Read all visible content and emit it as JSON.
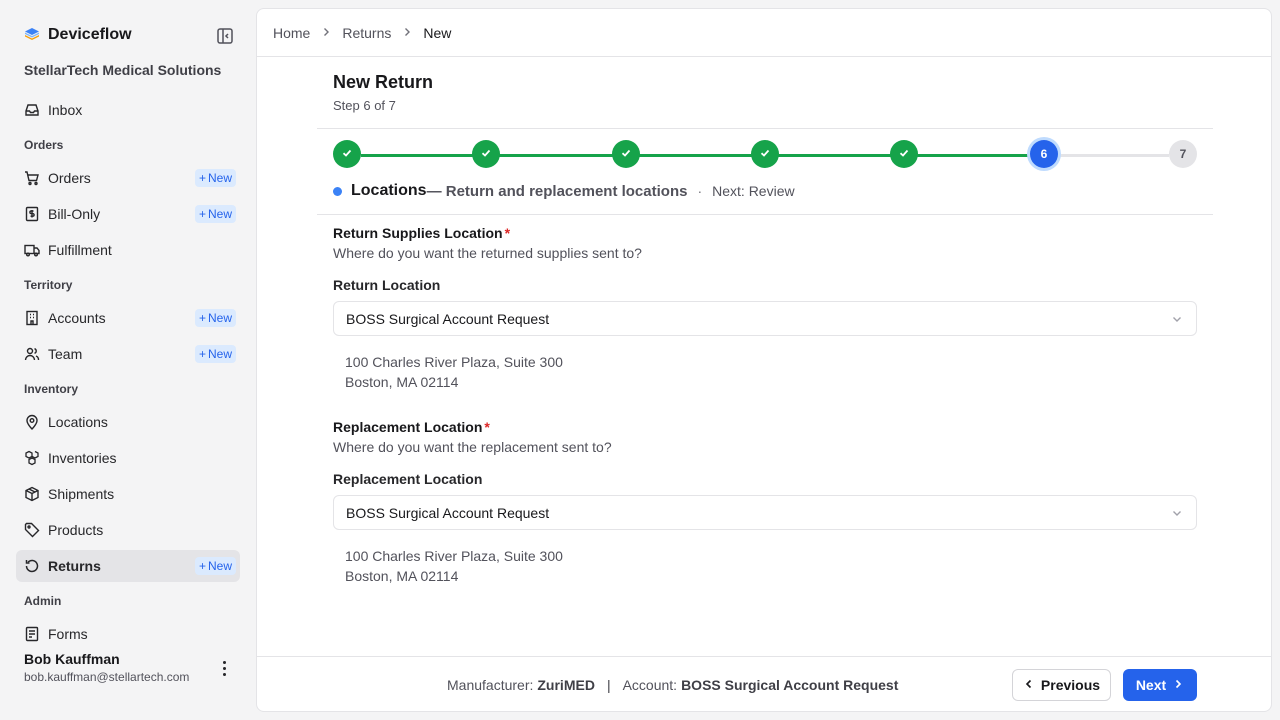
{
  "app": {
    "name": "Deviceflow",
    "org": "StellarTech Medical Solutions",
    "logo_icon": "layers-logo-icon"
  },
  "sidebar": {
    "items": [
      {
        "type": "item",
        "label": "Inbox",
        "icon": "inbox-icon"
      },
      {
        "type": "section",
        "label": "Orders"
      },
      {
        "type": "item",
        "label": "Orders",
        "icon": "cart-icon",
        "badge": "New"
      },
      {
        "type": "item",
        "label": "Bill-Only",
        "icon": "dollar-receipt-icon",
        "badge": "New"
      },
      {
        "type": "item",
        "label": "Fulfillment",
        "icon": "truck-icon"
      },
      {
        "type": "section",
        "label": "Territory"
      },
      {
        "type": "item",
        "label": "Accounts",
        "icon": "building-icon",
        "badge": "New"
      },
      {
        "type": "item",
        "label": "Team",
        "icon": "users-icon",
        "badge": "New"
      },
      {
        "type": "section",
        "label": "Inventory"
      },
      {
        "type": "item",
        "label": "Locations",
        "icon": "map-pin-icon"
      },
      {
        "type": "item",
        "label": "Inventories",
        "icon": "boxes-icon"
      },
      {
        "type": "item",
        "label": "Shipments",
        "icon": "package-icon"
      },
      {
        "type": "item",
        "label": "Products",
        "icon": "tag-icon"
      },
      {
        "type": "item",
        "label": "Returns",
        "icon": "rotate-ccw-icon",
        "badge": "New",
        "active": true
      },
      {
        "type": "section",
        "label": "Admin"
      },
      {
        "type": "item",
        "label": "Forms",
        "icon": "form-icon"
      }
    ]
  },
  "user": {
    "name": "Bob Kauffman",
    "email": "bob.kauffman@stellartech.com"
  },
  "breadcrumb": {
    "home": "Home",
    "returns": "Returns",
    "current": "New"
  },
  "header": {
    "title": "New Return",
    "subtitle": "Step 6 of 7"
  },
  "stepper": {
    "total": 7,
    "current": 6,
    "current_label": "6",
    "next_label": "7",
    "step_name": "Locations",
    "step_desc": "— Return and replacement locations",
    "separator": "·",
    "next_text": "Next: Review",
    "colors": {
      "done": "#16a34a",
      "current": "#2563eb",
      "todo": "#e4e4e7"
    }
  },
  "return_section": {
    "title": "Return Supplies Location",
    "required_mark": "*",
    "description": "Where do you want the returned supplies sent to?",
    "field_label": "Return Location",
    "selected": "BOSS Surgical Account Request",
    "address_line1": "100 Charles River Plaza, Suite 300",
    "address_line2": "Boston, MA 02114"
  },
  "replacement_section": {
    "title": "Replacement Location",
    "required_mark": "*",
    "description": "Where do you want the replacement sent to?",
    "field_label": "Replacement Location",
    "selected": "BOSS Surgical Account Request",
    "address_line1": "100 Charles River Plaza, Suite 300",
    "address_line2": "Boston, MA 02114"
  },
  "footer": {
    "manufacturer_label": "Manufacturer:",
    "manufacturer": "ZuriMED",
    "divider": "|",
    "account_label": "Account:",
    "account": "BOSS Surgical Account Request",
    "previous_label": "Previous",
    "next_label": "Next"
  }
}
